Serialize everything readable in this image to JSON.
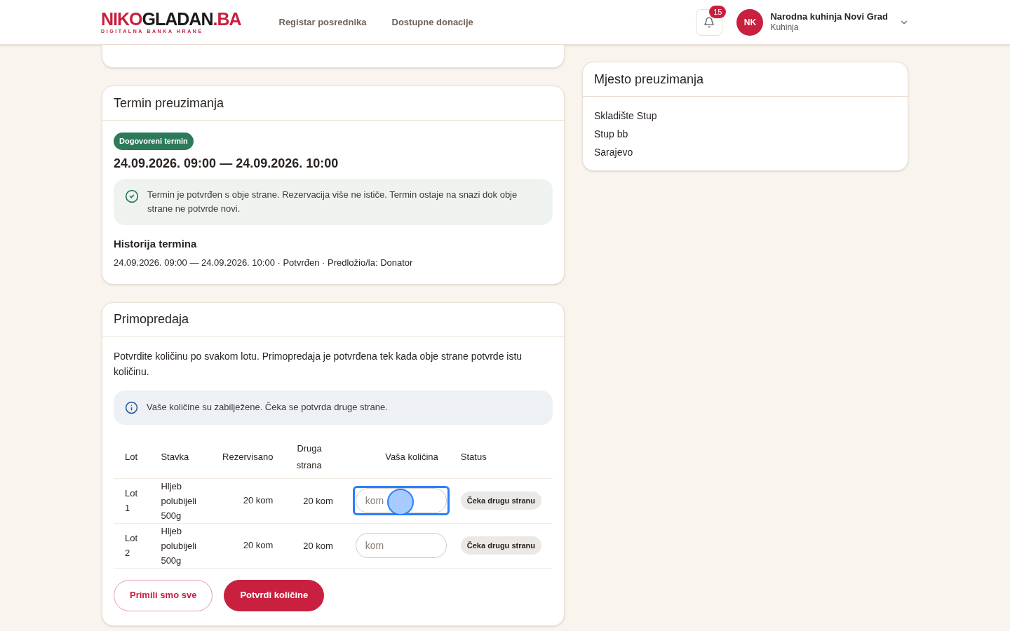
{
  "header": {
    "logo": {
      "part_1": "NIKO",
      "part_2": "GLADAN",
      "part_3": ".BA",
      "tagline": "DIGITALNA BANKA HRANE"
    },
    "nav": [
      {
        "label": "Registar posrednika"
      },
      {
        "label": "Dostupne donacije"
      }
    ],
    "notifications": {
      "count": "15"
    },
    "user": {
      "initials": "NK",
      "name": "Narodna kuhinja Novi Grad",
      "role": "Kuhinja"
    }
  },
  "termin": {
    "title": "Termin preuzimanja",
    "badge": "Dogovoreni termin",
    "range": "24.09.2026. 09:00 — 24.09.2026. 10:00",
    "notice": "Termin je potvrđen s obje strane. Rezervacija više ne ističe. Termin ostaje na snazi dok obje strane ne potvrde novi.",
    "history_title": "Historija termina",
    "history": [
      "24.09.2026. 09:00 — 24.09.2026. 10:00 · Potvrđen · Predložio/la: Donator"
    ]
  },
  "handover": {
    "title": "Primopredaja",
    "intro": "Potvrdite količinu po svakom lotu. Primopredaja je potvrđena tek kada obje strane potvrde istu količinu.",
    "notice": "Vaše količine su zabilježene. Čeka se potvrda druge strane.",
    "columns": [
      "Lot",
      "Stavka",
      "Rezervisano",
      "Druga strana",
      "Vaša količina",
      "Status"
    ],
    "rows": [
      {
        "lot": "Lot 1",
        "item": "Hljeb polubijeli 500g",
        "reserved": "20 kom",
        "other": "20 kom",
        "placeholder": "kom",
        "focused": true,
        "status": "Čeka drugu stranu"
      },
      {
        "lot": "Lot 2",
        "item": "Hljeb polubijeli 500g",
        "reserved": "20 kom",
        "other": "20 kom",
        "placeholder": "kom",
        "focused": false,
        "status": "Čeka drugu stranu"
      }
    ],
    "buttons": [
      {
        "label": "Primili smo sve",
        "kind": "outline"
      },
      {
        "label": "Potvrdi količine",
        "kind": "primary"
      }
    ]
  },
  "location": {
    "title": "Mjesto preuzimanja",
    "lines": [
      "Skladište Stup",
      "Stup bb",
      "Sarajevo"
    ]
  }
}
